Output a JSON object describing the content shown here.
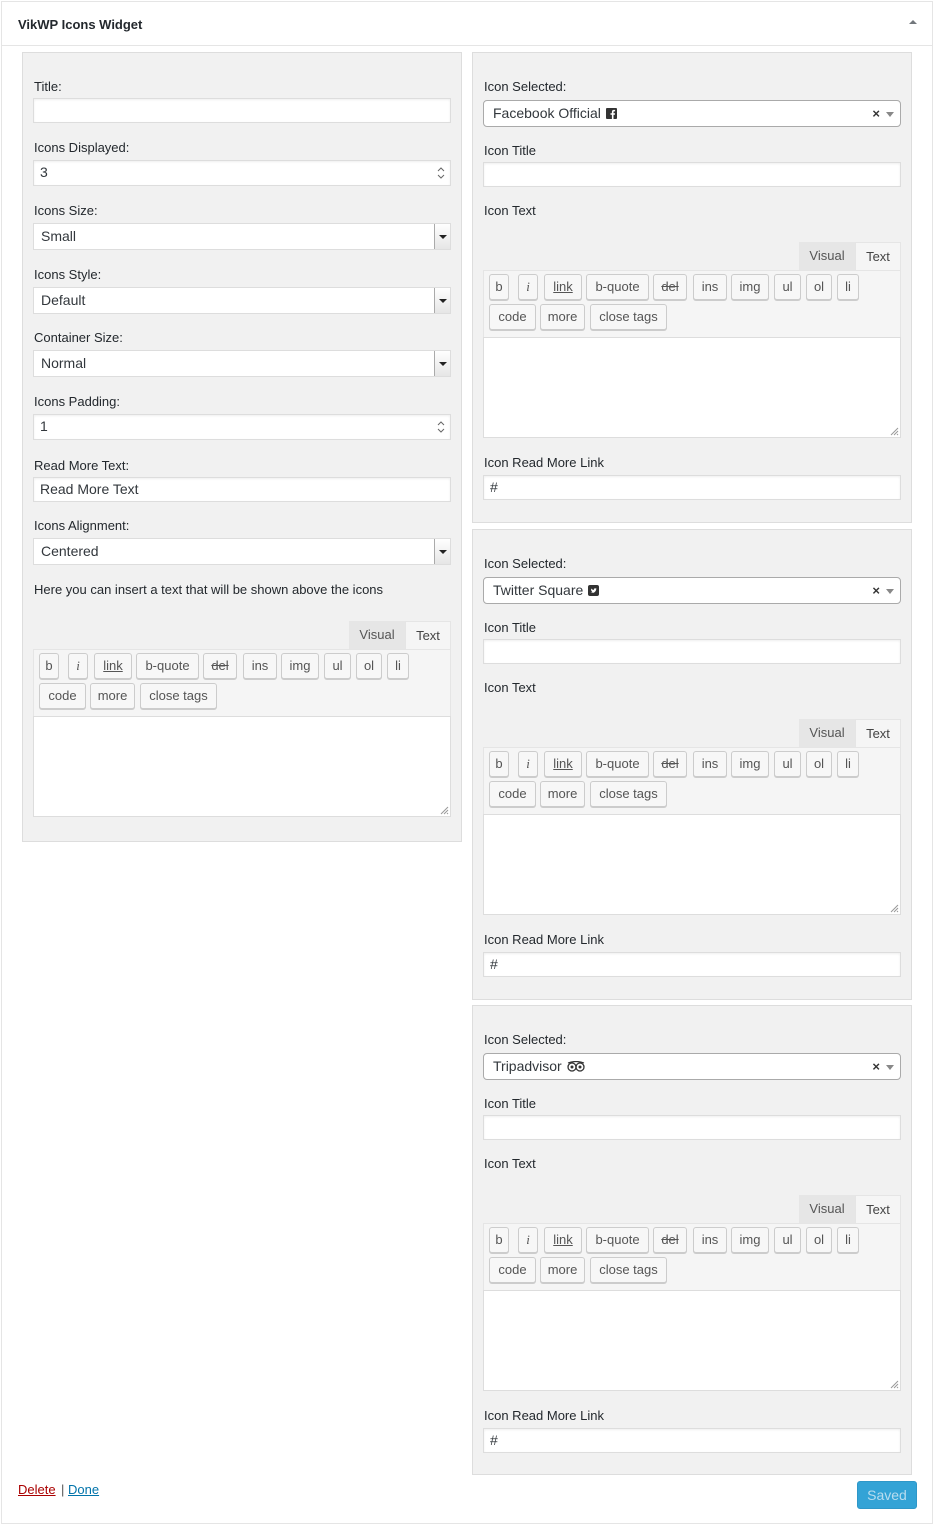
{
  "widget": {
    "title": "VikWP Icons Widget",
    "toggle_icon": "arrow-up-icon"
  },
  "settings": {
    "title_label": "Title:",
    "title_value": "",
    "icons_displayed_label": "Icons Displayed:",
    "icons_displayed_value": "3",
    "icons_size_label": "Icons Size:",
    "icons_size_value": "Small",
    "icons_style_label": "Icons Style:",
    "icons_style_value": "Default",
    "container_size_label": "Container Size:",
    "container_size_value": "Normal",
    "icons_padding_label": "Icons Padding:",
    "icons_padding_value": "1",
    "read_more_label": "Read More Text:",
    "read_more_value": "Read More Text",
    "alignment_label": "Icons Alignment:",
    "alignment_value": "Centered",
    "help_text": "Here you can insert a text that will be shown above the icons"
  },
  "editor": {
    "tab_visual": "Visual",
    "tab_text": "Text",
    "buttons": [
      "b",
      "i",
      "link",
      "b-quote",
      "del",
      "ins",
      "img",
      "ul",
      "ol",
      "li",
      "code",
      "more",
      "close tags"
    ]
  },
  "icons": [
    {
      "selected_label": "Icon Selected:",
      "selected_value": "Facebook Official",
      "glyph": "facebook-official-icon",
      "title_label": "Icon Title",
      "title_value": "",
      "text_label": "Icon Text",
      "link_label": "Icon Read More Link",
      "link_value": "#"
    },
    {
      "selected_label": "Icon Selected:",
      "selected_value": "Twitter Square",
      "glyph": "twitter-square-icon",
      "title_label": "Icon Title",
      "title_value": "",
      "text_label": "Icon Text",
      "link_label": "Icon Read More Link",
      "link_value": "#"
    },
    {
      "selected_label": "Icon Selected:",
      "selected_value": "Tripadvisor",
      "glyph": "tripadvisor-icon",
      "title_label": "Icon Title",
      "title_value": "",
      "text_label": "Icon Text",
      "link_label": "Icon Read More Link",
      "link_value": "#"
    }
  ],
  "select_clear": "×",
  "footer": {
    "delete": "Delete",
    "separator": "|",
    "done": "Done",
    "saved": "Saved"
  },
  "colors": {
    "link": "#0073aa",
    "delete": "#a00",
    "saved_button": "#33a3d6"
  }
}
